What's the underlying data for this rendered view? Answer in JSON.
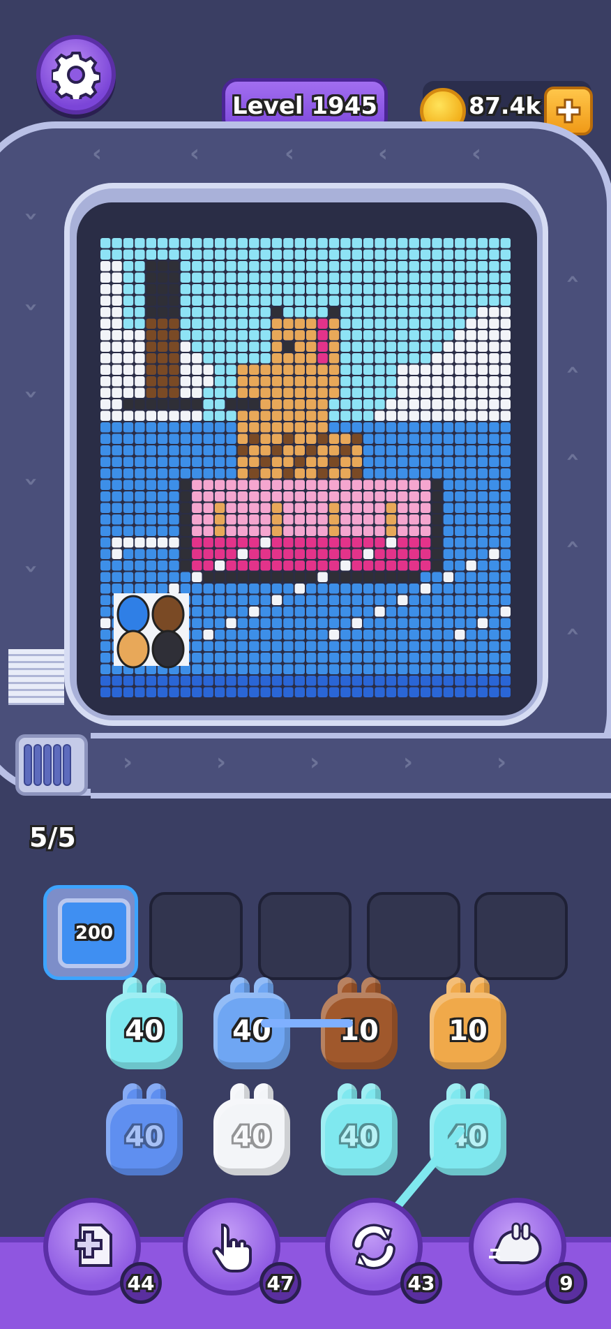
{
  "header": {
    "settings_icon": "gear-icon",
    "level_label": "Level 1945",
    "coins": "87.4k",
    "coin_icon": "gold-coin-icon",
    "add_coins_icon": "plus-icon"
  },
  "conveyor": {
    "counter": "5/5"
  },
  "slots": {
    "filled_value": "200"
  },
  "rabbits": [
    {
      "value": "40",
      "color": "#7fe8ef"
    },
    {
      "value": "40",
      "color": "#6fa6f3"
    },
    {
      "value": "10",
      "color": "#a0582c"
    },
    {
      "value": "10",
      "color": "#f0a94a"
    },
    {
      "value": "40",
      "color": "#5f8ff0"
    },
    {
      "value": "40",
      "color": "#f3f5f8"
    },
    {
      "value": "40",
      "color": "#7fe8ef"
    },
    {
      "value": "40",
      "color": "#7fe8ef"
    }
  ],
  "tools": [
    {
      "icon": "add-slot-icon",
      "count": "44"
    },
    {
      "icon": "hand-pointer-icon",
      "count": "47"
    },
    {
      "icon": "shuffle-icon",
      "count": "43"
    },
    {
      "icon": "rocket-rabbit-icon",
      "count": "9"
    }
  ],
  "palette": {
    "sky": "#8ee3f5",
    "cloud": "#f2f4f8",
    "sea": "#3d8fe8",
    "sea_dark": "#2a66d6",
    "tan": "#e8a859",
    "brown": "#7a4a25",
    "black": "#2f2f37",
    "pink": "#f5a6cf",
    "magenta": "#e3338a",
    "blue_egg": "#2f7fe6",
    "tan_egg": "#e8a859"
  }
}
